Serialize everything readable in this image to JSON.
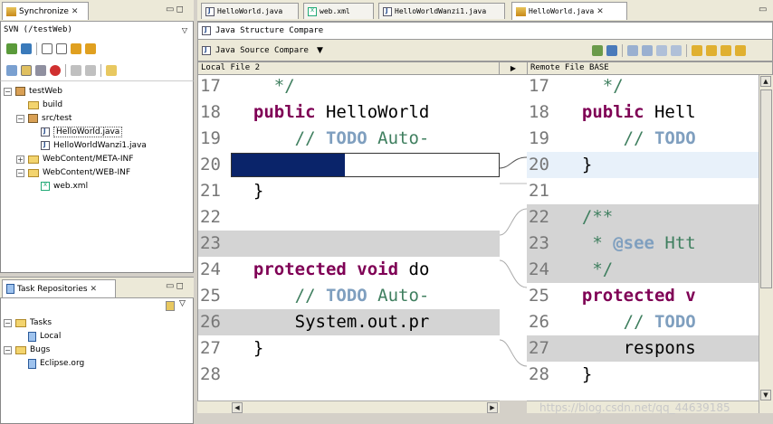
{
  "sync_view": {
    "tab_label": "Synchronize",
    "subtitle": "SVN (/testWeb)",
    "tree": [
      {
        "label": "testWeb",
        "depth": 0,
        "toggle": "−",
        "icon": "project-icon"
      },
      {
        "label": "build",
        "depth": 1,
        "toggle": "",
        "icon": "folder-icon"
      },
      {
        "label": "src/test",
        "depth": 1,
        "toggle": "−",
        "icon": "package-icon"
      },
      {
        "label": "HelloWorld.java",
        "depth": 2,
        "toggle": "",
        "icon": "java-file-icon",
        "selected": true
      },
      {
        "label": "HelloWorldWanzi1.java",
        "depth": 2,
        "toggle": "",
        "icon": "java-file-icon"
      },
      {
        "label": "WebContent/META-INF",
        "depth": 1,
        "toggle": "+",
        "icon": "folder-icon"
      },
      {
        "label": "WebContent/WEB-INF",
        "depth": 1,
        "toggle": "−",
        "icon": "folder-icon"
      },
      {
        "label": "web.xml",
        "depth": 2,
        "toggle": "",
        "icon": "xml-file-icon"
      }
    ]
  },
  "task_view": {
    "tab_label": "Task Repositories",
    "tree": [
      {
        "label": "Tasks",
        "depth": 0,
        "toggle": "−",
        "icon": "folder-icon"
      },
      {
        "label": "Local",
        "depth": 1,
        "toggle": "",
        "icon": "repository-icon"
      },
      {
        "label": "Bugs",
        "depth": 0,
        "toggle": "−",
        "icon": "folder-icon"
      },
      {
        "label": "Eclipse.org",
        "depth": 1,
        "toggle": "",
        "icon": "repository-icon"
      }
    ]
  },
  "editor_tabs": [
    {
      "label": "HelloWorld.java",
      "icon": "java-file-icon",
      "active": false
    },
    {
      "label": "web.xml",
      "icon": "xml-file-icon",
      "active": false
    },
    {
      "label": "HelloWorldWanzi1.java",
      "icon": "java-file-icon",
      "active": false
    },
    {
      "label": "HelloWorld.java",
      "icon": "sync-compare-icon",
      "active": true
    }
  ],
  "compare": {
    "structure_label": "Java Structure Compare",
    "source_label": "Java Source Compare",
    "left_title": "Local File 2",
    "right_title": "Remote File BASE",
    "left_lines": [
      {
        "n": "17",
        "segs": [
          {
            "t": "    */",
            "c": "cm"
          }
        ]
      },
      {
        "n": "18",
        "segs": [
          {
            "t": "  ",
            "c": ""
          },
          {
            "t": "public",
            "c": "kw"
          },
          {
            "t": " HelloWorld",
            "c": ""
          }
        ]
      },
      {
        "n": "19",
        "segs": [
          {
            "t": "      ",
            "c": ""
          },
          {
            "t": "// ",
            "c": "cm"
          },
          {
            "t": "TODO",
            "c": "td"
          },
          {
            "t": " Auto-",
            "c": "cm"
          }
        ]
      },
      {
        "n": "20",
        "segs": [],
        "kind": "selected"
      },
      {
        "n": "21",
        "segs": [
          {
            "t": "  }",
            "c": ""
          }
        ]
      },
      {
        "n": "22",
        "segs": []
      },
      {
        "n": "23",
        "segs": [],
        "kind": "gray"
      },
      {
        "n": "24",
        "segs": [
          {
            "t": "  ",
            "c": ""
          },
          {
            "t": "protected",
            "c": "kw"
          },
          {
            "t": " ",
            "c": ""
          },
          {
            "t": "void",
            "c": "kw"
          },
          {
            "t": " do",
            "c": ""
          }
        ]
      },
      {
        "n": "25",
        "segs": [
          {
            "t": "      ",
            "c": ""
          },
          {
            "t": "// ",
            "c": "cm"
          },
          {
            "t": "TODO",
            "c": "td"
          },
          {
            "t": " Auto-",
            "c": "cm"
          }
        ]
      },
      {
        "n": "26",
        "segs": [
          {
            "t": "      System.out.pr",
            "c": ""
          }
        ],
        "kind": "gray"
      },
      {
        "n": "27",
        "segs": [
          {
            "t": "  }",
            "c": ""
          }
        ]
      },
      {
        "n": "28",
        "segs": []
      }
    ],
    "right_lines": [
      {
        "n": "17",
        "segs": [
          {
            "t": "    */",
            "c": "cm"
          }
        ]
      },
      {
        "n": "18",
        "segs": [
          {
            "t": "  ",
            "c": ""
          },
          {
            "t": "public",
            "c": "kw"
          },
          {
            "t": " Hell",
            "c": ""
          }
        ]
      },
      {
        "n": "19",
        "segs": [
          {
            "t": "      ",
            "c": ""
          },
          {
            "t": "// ",
            "c": "cm"
          },
          {
            "t": "TODO",
            "c": "td"
          }
        ]
      },
      {
        "n": "20",
        "segs": [
          {
            "t": "  }",
            "c": ""
          }
        ],
        "kind": "hl"
      },
      {
        "n": "21",
        "segs": []
      },
      {
        "n": "22",
        "segs": [
          {
            "t": "  /**",
            "c": "cm"
          }
        ],
        "kind": "gray"
      },
      {
        "n": "23",
        "segs": [
          {
            "t": "   * ",
            "c": "cm"
          },
          {
            "t": "@see",
            "c": "td"
          },
          {
            "t": " Htt",
            "c": "cm"
          }
        ],
        "kind": "gray"
      },
      {
        "n": "24",
        "segs": [
          {
            "t": "   */",
            "c": "cm"
          }
        ],
        "kind": "gray"
      },
      {
        "n": "25",
        "segs": [
          {
            "t": "  ",
            "c": ""
          },
          {
            "t": "protected",
            "c": "kw"
          },
          {
            "t": " v",
            "c": "kw"
          }
        ]
      },
      {
        "n": "26",
        "segs": [
          {
            "t": "      ",
            "c": ""
          },
          {
            "t": "// ",
            "c": "cm"
          },
          {
            "t": "TODO",
            "c": "td"
          }
        ]
      },
      {
        "n": "27",
        "segs": [
          {
            "t": "      respons",
            "c": ""
          }
        ],
        "kind": "gray"
      },
      {
        "n": "28",
        "segs": [
          {
            "t": "  }",
            "c": ""
          }
        ]
      }
    ]
  },
  "watermark": "https://blog.csdn.net/qq_44639185",
  "colors": {
    "selection": "#0a246a",
    "highlight": "#e8f1fa",
    "changed": "#d4d4d4"
  }
}
